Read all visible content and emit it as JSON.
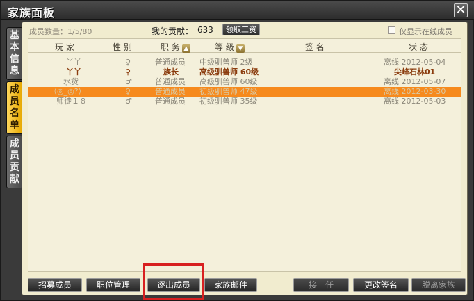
{
  "window": {
    "title": "家族面板",
    "close_label": "✕"
  },
  "tabs": [
    {
      "label": [
        "基",
        "本",
        "信",
        "息"
      ],
      "active": false
    },
    {
      "label": [
        "成",
        "员",
        "名",
        "单"
      ],
      "active": true
    },
    {
      "label": [
        "成",
        "员",
        "贡",
        "献"
      ],
      "active": false
    }
  ],
  "topbar": {
    "member_count": "成员数量：1/5/80",
    "contribution_label": "我的贡献：",
    "contribution_value": "633",
    "salary_button": "领取工资",
    "online_only_label": "仅显示在线成员"
  },
  "table": {
    "headers": {
      "player": "玩 家",
      "gender": "性 别",
      "role": "职 务",
      "level": "等 级",
      "signature": "签 名",
      "status": "状 态"
    },
    "sort_icons": {
      "role": "up-arrow-icon",
      "level": "down-arrow-icon"
    },
    "rows": [
      {
        "player": "丫丫",
        "gender": "♀",
        "role": "普通成员",
        "level": "中级驯兽师 2级",
        "signature": "",
        "status": "离线 2012-05-04",
        "type": "normal"
      },
      {
        "player": "丫丫",
        "gender": "♀",
        "role": "族长",
        "level": "高级驯兽师 60级",
        "signature": "",
        "status": "尖峰石林01",
        "type": "leader"
      },
      {
        "player": "水货",
        "gender": "♂",
        "role": "普通成员",
        "level": "高级驯兽师 60级",
        "signature": "",
        "status": "离线 2012-05-07",
        "type": "normal"
      },
      {
        "player": "（◎_◎?）",
        "gender": "♀",
        "role": "普通成员",
        "level": "初级驯兽师 47级",
        "signature": "",
        "status": "离线 2012-03-30",
        "type": "selected"
      },
      {
        "player": "师徒１８",
        "gender": "♂",
        "role": "普通成员",
        "level": "初级驯兽师 35级",
        "signature": "",
        "status": "离线 2012-05-03",
        "type": "normal"
      }
    ]
  },
  "bottom_buttons": {
    "recruit": "招募成员",
    "position_manage": "职位管理",
    "kick_member": "逐出成员",
    "family_mail": "家族邮件",
    "succeed": "接　任",
    "edit_signature": "更改签名",
    "leave_family": "脱离家族"
  },
  "colors": {
    "accent": "#f68a1d",
    "highlight_box": "#d82020",
    "leader_text": "#8a3b0d",
    "panel_bg": "#f1eccf"
  }
}
